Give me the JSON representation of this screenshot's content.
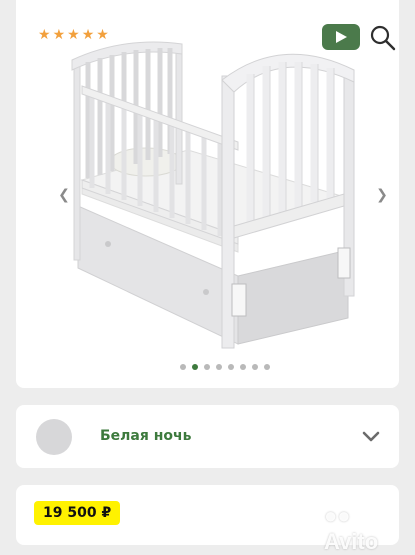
{
  "gallery": {
    "rating_stars": 5,
    "slide_count": 8,
    "active_slide": 2
  },
  "variant": {
    "color_name": "Белая ночь",
    "swatch_color": "#d7d7d9"
  },
  "price": {
    "text": "19 500 ₽"
  },
  "watermark": {
    "text": "Avito"
  },
  "colors": {
    "accent_green": "#3d7a3d",
    "video_button": "#4b7a4b",
    "star": "#f2a03d",
    "price_badge": "#fff200"
  },
  "icons": {
    "video": "play-icon",
    "zoom": "search-icon",
    "prev": "chevron-left-icon",
    "next": "chevron-right-icon",
    "expand": "chevron-down-icon"
  }
}
